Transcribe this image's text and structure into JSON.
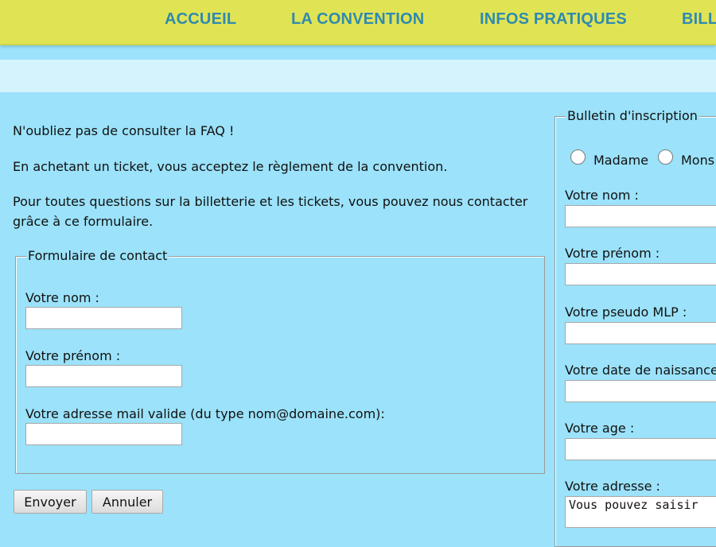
{
  "nav": {
    "items": [
      {
        "label": "ACCUEIL"
      },
      {
        "label": "LA CONVENTION"
      },
      {
        "label": "INFOS PRATIQUES"
      },
      {
        "label": "BILL"
      }
    ]
  },
  "intro": {
    "faq": "N'oubliez pas de consulter la FAQ !",
    "rules": "En achetant un ticket, vous acceptez le règlement de la convention.",
    "contact_line1": "Pour toutes questions sur la billetterie et les tickets, vous pouvez nous contacter",
    "contact_line2": "grâce à ce formulaire."
  },
  "contact_form": {
    "legend": "Formulaire de contact",
    "name_label": "Votre nom :",
    "name_value": "",
    "firstname_label": "Votre prénom :",
    "firstname_value": "",
    "email_label": "Votre adresse mail valide (du type nom@domaine.com):",
    "email_value": "",
    "submit_label": "Envoyer",
    "cancel_label": "Annuler"
  },
  "registration": {
    "legend": "Bulletin d'inscription",
    "title_options": [
      "Madame",
      "Mons"
    ],
    "name_label": "Votre nom :",
    "firstname_label": "Votre prénom :",
    "pseudo_label": "Votre pseudo MLP :",
    "birthdate_label": "Votre date de naissance",
    "age_label": "Votre age :",
    "address_label": "Votre adresse :",
    "address_placeholder": "Vous pouvez saisir"
  },
  "colors": {
    "nav_background": "#e0e454",
    "nav_link": "#2f8ab0",
    "page_background": "#9be2fa",
    "light_band": "#d5f3fd"
  }
}
